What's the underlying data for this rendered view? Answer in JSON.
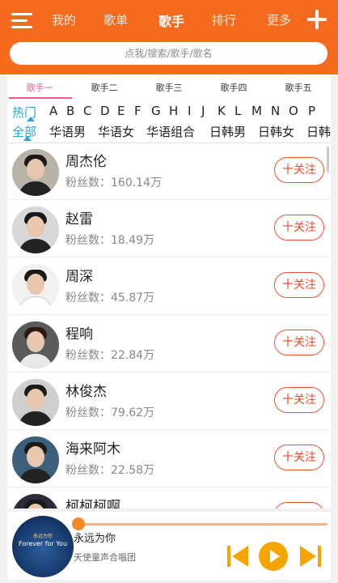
{
  "nav": {
    "tabs": [
      "我的",
      "歌单",
      "歌手",
      "排行",
      "更多"
    ],
    "active_tab": "歌手"
  },
  "search": {
    "placeholder": "点我/搜索/歌手/歌名"
  },
  "subtabs": [
    "歌手一",
    "歌手二",
    "歌手三",
    "歌手四",
    "歌手五"
  ],
  "filters": {
    "letters": [
      "热门",
      "A",
      "B",
      "C",
      "D",
      "E",
      "F",
      "G",
      "H",
      "I",
      "J",
      "K",
      "L",
      "M",
      "N",
      "O",
      "P"
    ],
    "categories": [
      "全部",
      "华语男",
      "华语女",
      "华语组合",
      "日韩男",
      "日韩女",
      "日韩"
    ]
  },
  "follow_label": "十关注",
  "artists": [
    {
      "name": "周杰伦",
      "fans": "粉丝数：160.14万"
    },
    {
      "name": "赵雷",
      "fans": "粉丝数：18.49万"
    },
    {
      "name": "周深",
      "fans": "粉丝数：45.87万"
    },
    {
      "name": "程响",
      "fans": "粉丝数：22.84万"
    },
    {
      "name": "林俊杰",
      "fans": "粉丝数：79.62万"
    },
    {
      "name": "海来阿木",
      "fans": "粉丝数：22.58万"
    },
    {
      "name": "柯柯柯啊",
      "fans": ""
    }
  ],
  "player": {
    "song": "永远为你",
    "artist": "天使童声合唱团",
    "cover_text_top": "永远为你",
    "cover_text_main": "Forever for You",
    "progress": 0.0
  },
  "colors": {
    "brand": "#f76b1c",
    "tab_active": "#ef5b8a",
    "filter_active": "#29a3d8",
    "follow": "#ec4a28",
    "control": "#f5a400"
  }
}
